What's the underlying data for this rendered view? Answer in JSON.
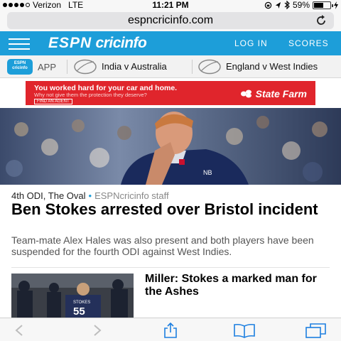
{
  "status_bar": {
    "carrier": "Verizon",
    "network": "LTE",
    "time": "11:21 PM",
    "battery_percent": "59%",
    "battery_level": 0.59,
    "signal_bars": 4
  },
  "browser": {
    "url": "espncricinfo.com",
    "reload_icon": "reload-icon",
    "toolbar_icons": [
      "back-arrow-icon",
      "forward-arrow-icon",
      "share-icon",
      "bookmarks-icon",
      "tabs-icon"
    ]
  },
  "site_header": {
    "logo_espn": "ESPN",
    "logo_cricinfo": "cricinfo",
    "login": "LOG IN",
    "scores": "SCORES",
    "brand_color": "#1d9ed9"
  },
  "nav_strip": {
    "app_badge": "ESPN cricinfo",
    "app_label": "APP",
    "matches": [
      "India v Australia",
      "England v West Indies"
    ]
  },
  "ad": {
    "headline": "You worked hard for your car and home.",
    "subline": "Why not give them the protection they deserve?",
    "cta": "FIND AN AGENT",
    "brand": "State Farm",
    "color": "#e0252c"
  },
  "article": {
    "series": "4th ODI, The Oval",
    "author": "ESPNcricinfo staff",
    "headline": "Ben Stokes arrested over Bristol incident",
    "summary": "Team-mate Alex Hales was also present and both players have been suspended for the fourth ODI against West Indies."
  },
  "secondary_article": {
    "headline": "Miller: Stokes a marked man for the Ashes",
    "thumb_shirt_name": "STOKES",
    "thumb_shirt_number": "55"
  }
}
